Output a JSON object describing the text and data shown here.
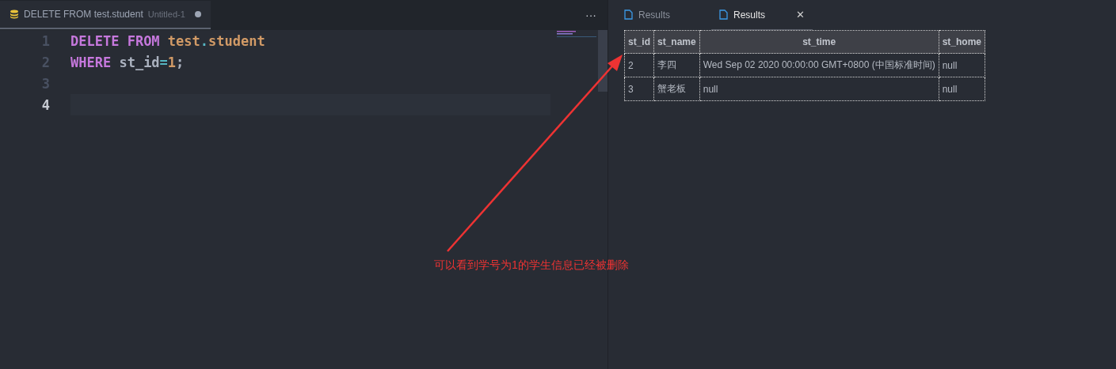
{
  "editor": {
    "tab": {
      "title": "DELETE FROM test.student",
      "subtitle": "Untitled-1",
      "modified": true
    },
    "more_actions": "···",
    "lines": [
      {
        "number": "1",
        "current": false,
        "tokens": [
          {
            "kind": "keyword",
            "text": "DELETE"
          },
          {
            "kind": "keyword",
            "text": "FROM",
            "spaced": true
          },
          {
            "kind": "name",
            "text": "test",
            "spaced": true
          },
          {
            "kind": "operator",
            "text": "."
          },
          {
            "kind": "name",
            "text": "student"
          }
        ]
      },
      {
        "number": "2",
        "current": false,
        "tokens": [
          {
            "kind": "keyword",
            "text": "WHERE"
          },
          {
            "kind": "identifier",
            "text": "st_id",
            "spaced": true
          },
          {
            "kind": "operator",
            "text": "="
          },
          {
            "kind": "number",
            "text": "1"
          },
          {
            "kind": "punct",
            "text": ";"
          }
        ]
      },
      {
        "number": "3",
        "current": false
      },
      {
        "number": "4",
        "current": true
      }
    ]
  },
  "results": {
    "tabs": [
      {
        "label": "Results",
        "selected": false,
        "closable": false
      },
      {
        "label": "Results",
        "selected": true,
        "closable": true
      }
    ],
    "close_glyph": "✕",
    "table": {
      "columns": [
        "st_id",
        "st_name",
        "st_time",
        "st_home"
      ],
      "rows": [
        [
          "2",
          "李四",
          "Wed Sep 02 2020 00:00:00 GMT+0800 (中国标准时间)",
          "null"
        ],
        [
          "3",
          "蟹老板",
          "null",
          "null"
        ]
      ]
    }
  },
  "annotation": {
    "text": "可以看到学号为1的学生信息已经被删除"
  }
}
